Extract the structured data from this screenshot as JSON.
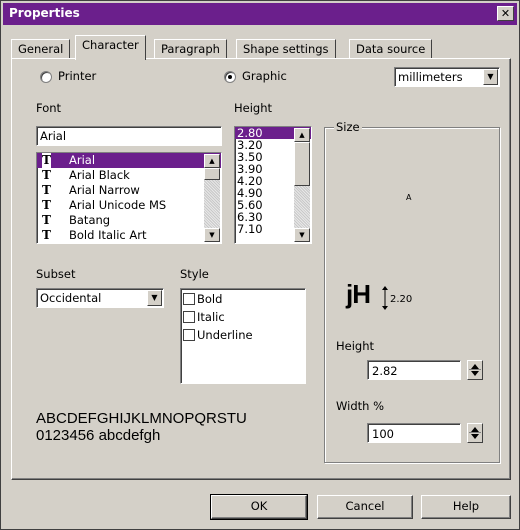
{
  "window": {
    "title": "Properties",
    "close_glyph": "✕"
  },
  "tabs": [
    "General",
    "Character",
    "Paragraph",
    "Shape settings",
    "Data source"
  ],
  "active_tab": "Character",
  "output": {
    "printer_label": "Printer",
    "graphic_label": "Graphic",
    "selected": "Graphic",
    "unit": "millimeters"
  },
  "font": {
    "label": "Font",
    "value": "Arial",
    "items": [
      "Arial",
      "Arial Black",
      "Arial Narrow",
      "Arial Unicode MS",
      "Batang",
      "Bold Italic Art"
    ],
    "selected": "Arial",
    "icon": "truetype-icon"
  },
  "height": {
    "label": "Height",
    "items": [
      "2.80",
      "3.20",
      "3.50",
      "3.90",
      "4.20",
      "4.90",
      "5.60",
      "6.30",
      "7.10"
    ],
    "selected": "2.80"
  },
  "subset": {
    "label": "Subset",
    "value": "Occidental"
  },
  "style": {
    "label": "Style",
    "options": [
      {
        "label": "Bold",
        "checked": false
      },
      {
        "label": "Italic",
        "checked": false
      },
      {
        "label": "Underline",
        "checked": false
      }
    ]
  },
  "sample": {
    "line1": "ABCDEFGHIJKLMNOPQRSTU",
    "line2": "0123456 abcdefgh"
  },
  "size_group": {
    "label": "Size",
    "preview_glyph": "A",
    "jh_text": "jH",
    "jh_value": "2.20",
    "height_label": "Height",
    "height_value": "2.82",
    "width_label": "Width %",
    "width_value": "100"
  },
  "buttons": {
    "ok": "OK",
    "cancel": "Cancel",
    "help": "Help"
  },
  "colors": {
    "accent": "#6b1f8c",
    "face": "#d4d0c8"
  }
}
